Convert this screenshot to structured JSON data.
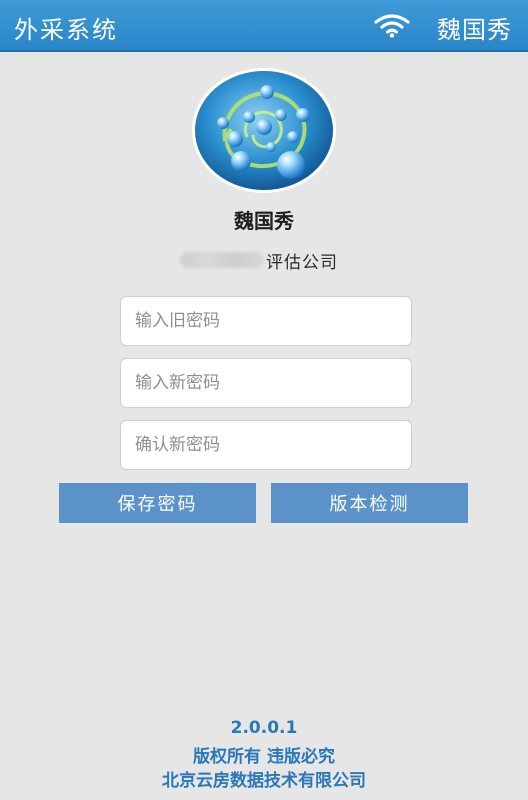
{
  "header": {
    "app_title": "外采系统",
    "user_name": "魏国秀",
    "wifi_icon": "wifi-icon"
  },
  "profile": {
    "avatar_icon": "app-logo-avatar",
    "name": "魏国秀",
    "company_suffix": "评估公司"
  },
  "form": {
    "old_password_placeholder": "输入旧密码",
    "new_password_placeholder": "输入新密码",
    "confirm_password_placeholder": "确认新密码",
    "save_label": "保存密码",
    "check_version_label": "版本检测"
  },
  "footer": {
    "version": "2.0.0.1",
    "copyright": "版权所有  违版必究",
    "company": "北京云房数据技术有限公司"
  },
  "colors": {
    "header_bg": "#2a86c9",
    "button_bg": "#5b93c9",
    "footer_text": "#2a78b8",
    "page_bg": "#e6e6e6"
  }
}
